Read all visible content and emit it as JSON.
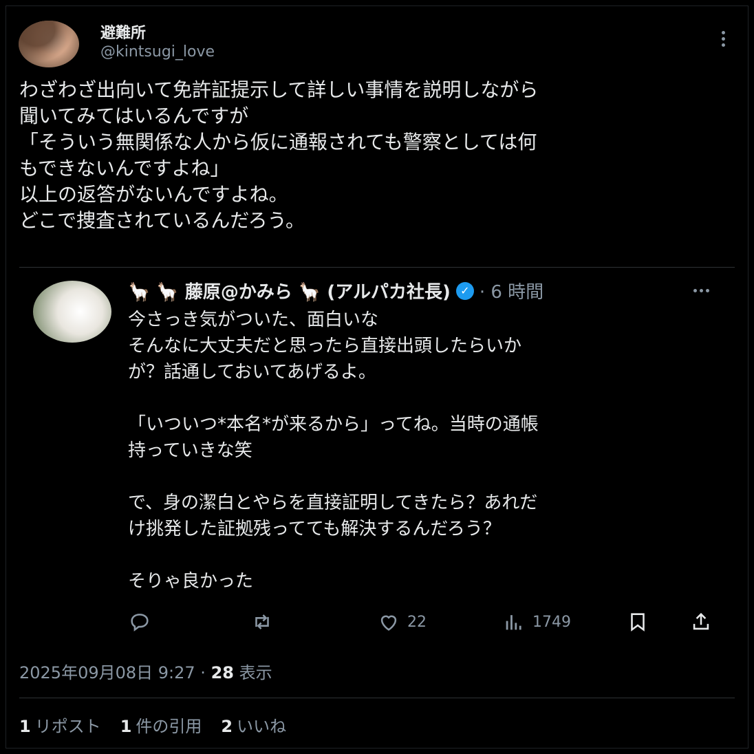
{
  "author": {
    "display_name": "避難所",
    "handle": "@kintsugi_love"
  },
  "tweet": {
    "text": "わざわざ出向いて免許証提示して詳しい事情を説明しながら\n聞いてみてはいるんですが\n「そういう無関係な人から仮に通報されても警察としては何\nもできないんですよね」\n以上の返答がないんですよね。\nどこで捜査されているんだろう。"
  },
  "quoted": {
    "display_name": "🦙 🦙 藤原@かみら 🦙 (アルパカ社長)",
    "verified_mark": "✓",
    "time": "· 6 時間",
    "text": "今さっき気がついた、面白いな\nそんなに大丈夫だと思ったら直接出頭したらいか\nが？話通しておいてあげるよ。\n\n「いついつ*本名*が来るから」ってね。当時の通帳\n持っていきな笑\n\nで、身の潔白とやらを直接証明してきたら？あれだ\nけ挑発した証拠残ってても解決するんだろう？\n\nそりゃ良かった",
    "likes": "22",
    "views": "1749"
  },
  "meta": {
    "timestamp": "2025年09月08日 9:27 · ",
    "views_count": "28",
    "views_label": " 表示"
  },
  "stats": {
    "reposts_count": "1",
    "reposts_label": "リポスト",
    "quotes_count": "1",
    "quotes_label": "件の引用",
    "likes_count": "2",
    "likes_label": "いいね"
  },
  "icons": [
    "reply-icon",
    "retweet-icon",
    "like-icon",
    "views-icon",
    "bookmark-icon",
    "share-icon",
    "more-icon",
    "verified-icon"
  ],
  "colors": {
    "background": "#000000",
    "text": "#e7e9ea",
    "muted": "#8b98a5",
    "verified": "#1d9bf0",
    "divider": "#2f3336"
  }
}
